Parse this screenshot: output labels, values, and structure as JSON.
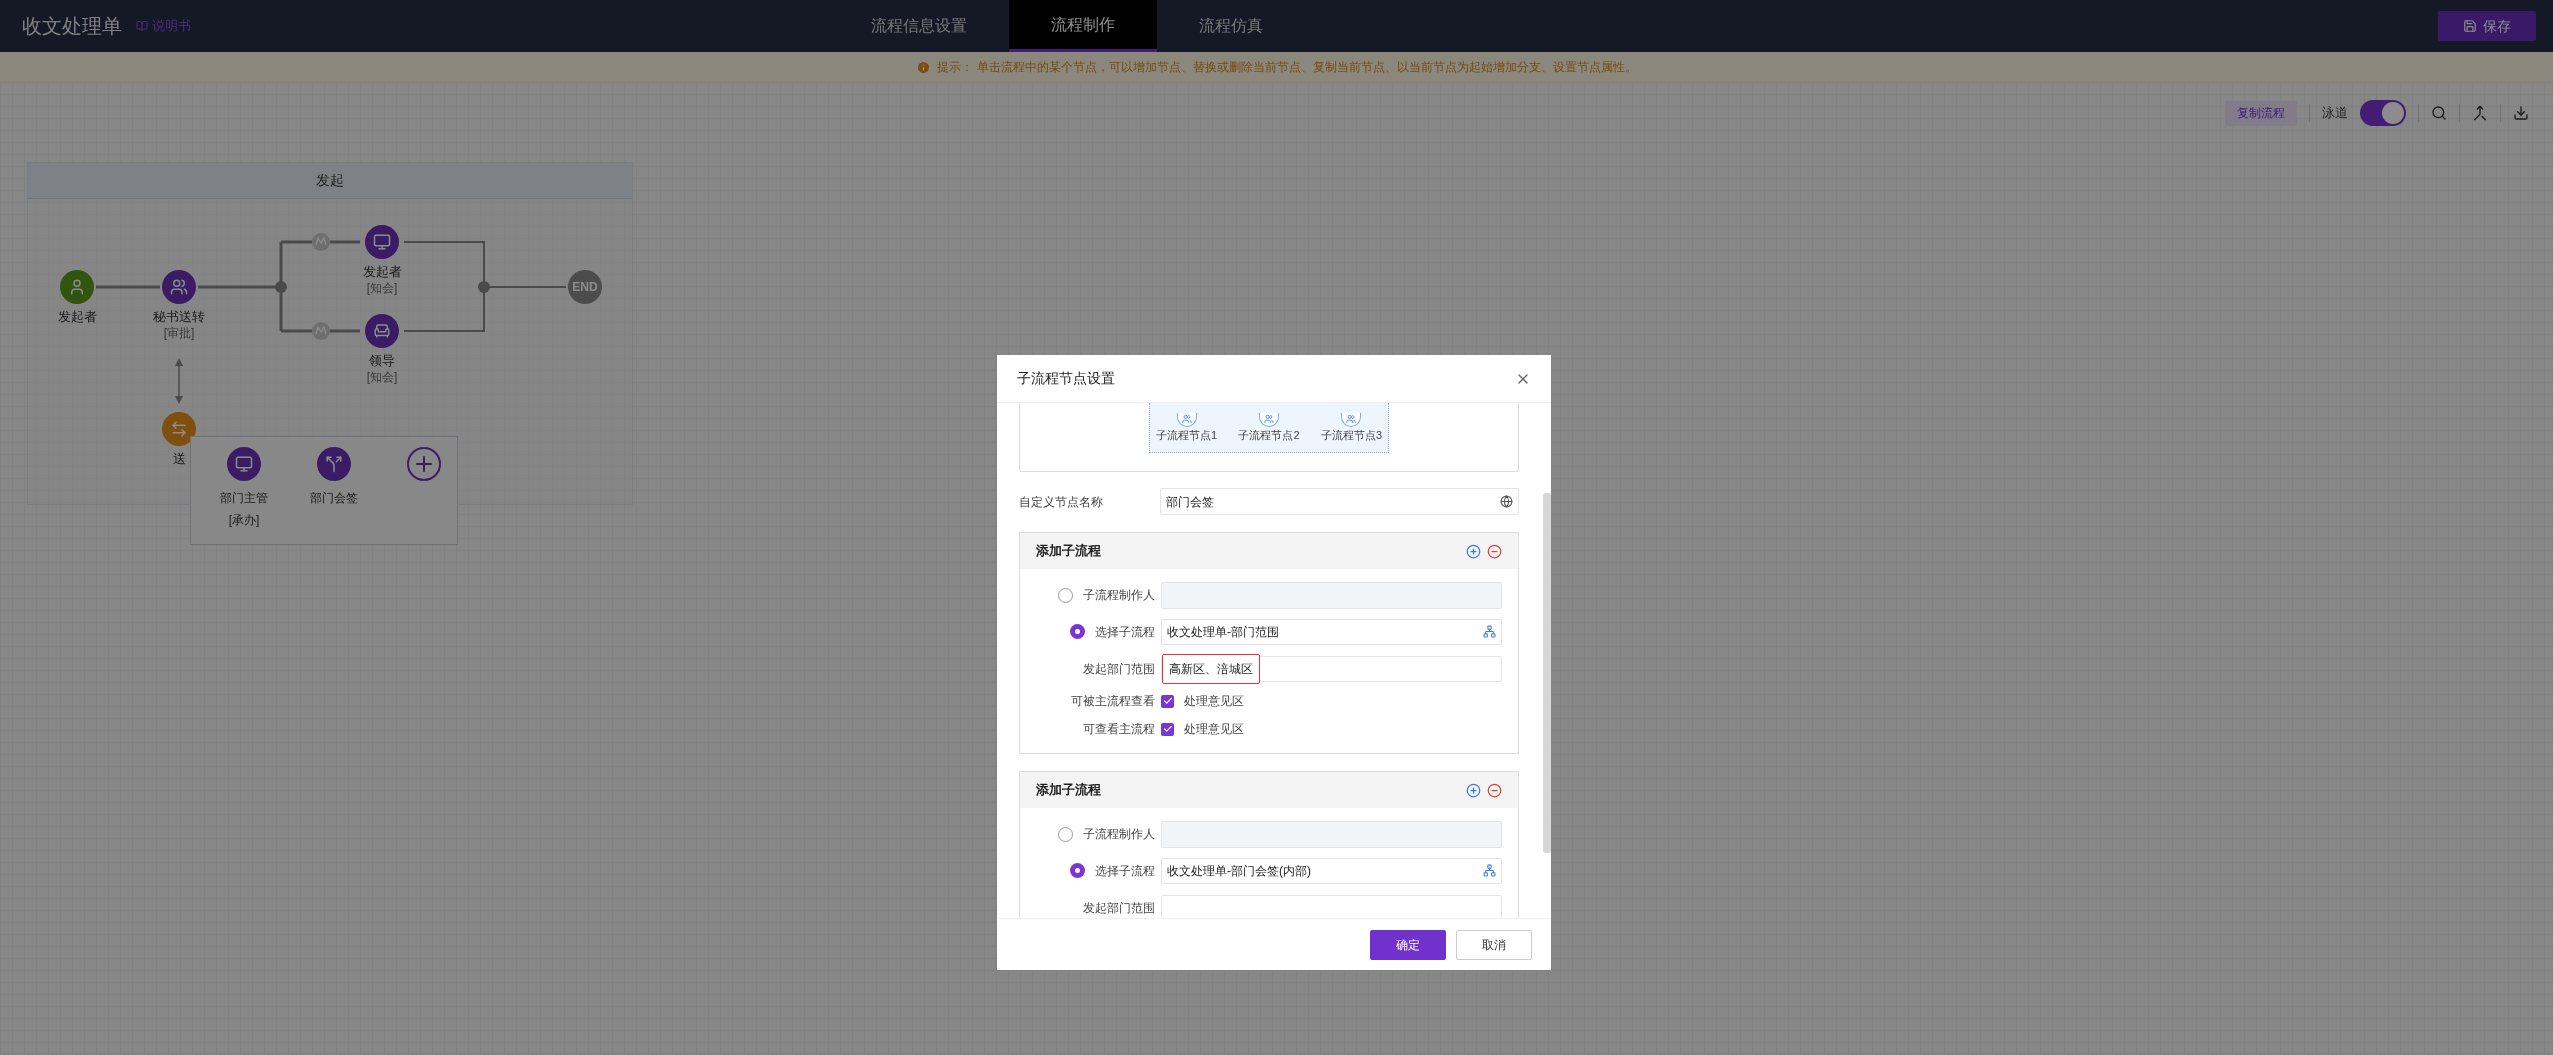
{
  "header": {
    "title": "收文处理单",
    "manual_link": "说明书",
    "tabs": [
      {
        "label": "流程信息设置",
        "selected": false
      },
      {
        "label": "流程制作",
        "selected": true
      },
      {
        "label": "流程仿真",
        "selected": false
      }
    ],
    "save_button": "保存"
  },
  "hint": "提示： 单击流程中的某个节点，可以增加节点、替换或删除当前节点、复制当前节点、以当前节点为起始增加分支、设置节点属性。",
  "toolbar": {
    "copy_button": "复制流程",
    "lane_label": "泳道",
    "lane_on": true
  },
  "lane": {
    "title": "发起"
  },
  "nodes": [
    {
      "kind": "start",
      "label": "发起者"
    },
    {
      "kind": "group",
      "label": "秘书送转",
      "sub": "[审批]"
    },
    {
      "kind": "screen",
      "label": "发起者",
      "sub": "[知会]"
    },
    {
      "kind": "desk",
      "label": "领导",
      "sub": "[知会]"
    },
    {
      "kind": "end",
      "label": "END"
    },
    {
      "kind": "swap",
      "label": "送"
    }
  ],
  "picker": [
    {
      "kind": "screen",
      "label": "部门主管",
      "sub": "[承办]"
    },
    {
      "kind": "branch",
      "label": "部门会签"
    },
    {
      "kind": "add"
    }
  ],
  "modal": {
    "title": "子流程节点设置",
    "preview_nodes": [
      "子流程节点1",
      "子流程节点2",
      "子流程节点3"
    ],
    "name_label": "自定义节点名称",
    "name_value": "部门会签",
    "sections": [
      {
        "title": "添加子流程",
        "maker_label": "子流程制作人",
        "maker_selected": false,
        "select_label": "选择子流程",
        "select_selected": true,
        "select_value": "收文处理单-部门范围",
        "range_label": "发起部门范围",
        "range_value": "高新区、涪城区",
        "range_highlighted": true,
        "checks": [
          {
            "label": "可被主流程查看",
            "option": "处理意见区",
            "checked": true
          },
          {
            "label": "可查看主流程",
            "option": "处理意见区",
            "checked": true
          }
        ]
      },
      {
        "title": "添加子流程",
        "maker_label": "子流程制作人",
        "maker_selected": false,
        "select_label": "选择子流程",
        "select_selected": true,
        "select_value": "收文处理单-部门会签(内部)",
        "range_label": "发起部门范围",
        "range_highlighted": false
      }
    ],
    "ok_button": "确定",
    "cancel_button": "取消"
  }
}
